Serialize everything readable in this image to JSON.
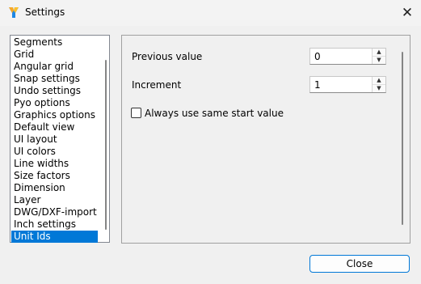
{
  "window": {
    "title": "Settings",
    "close_glyph": "✕",
    "icon": "settings-app-icon"
  },
  "sidebar": {
    "items": [
      {
        "label": "Segments"
      },
      {
        "label": "Grid"
      },
      {
        "label": "Angular grid"
      },
      {
        "label": "Snap settings"
      },
      {
        "label": "Undo settings"
      },
      {
        "label": "Pyo options"
      },
      {
        "label": "Graphics options"
      },
      {
        "label": "Default view"
      },
      {
        "label": "UI layout"
      },
      {
        "label": "UI colors"
      },
      {
        "label": "Line widths"
      },
      {
        "label": "Size factors"
      },
      {
        "label": "Dimension"
      },
      {
        "label": "Layer"
      },
      {
        "label": "DWG/DXF-import"
      },
      {
        "label": "Inch settings"
      },
      {
        "label": "Unit Ids"
      }
    ],
    "selected": "Unit Ids"
  },
  "panel": {
    "previous_value": {
      "label": "Previous value",
      "value": "0"
    },
    "increment": {
      "label": "Increment",
      "value": "1"
    },
    "same_start": {
      "label": "Always use same start value",
      "checked": false
    }
  },
  "footer": {
    "close_label": "Close"
  },
  "colors": {
    "selection": "#0078d7",
    "background": "#f0f0f0"
  }
}
